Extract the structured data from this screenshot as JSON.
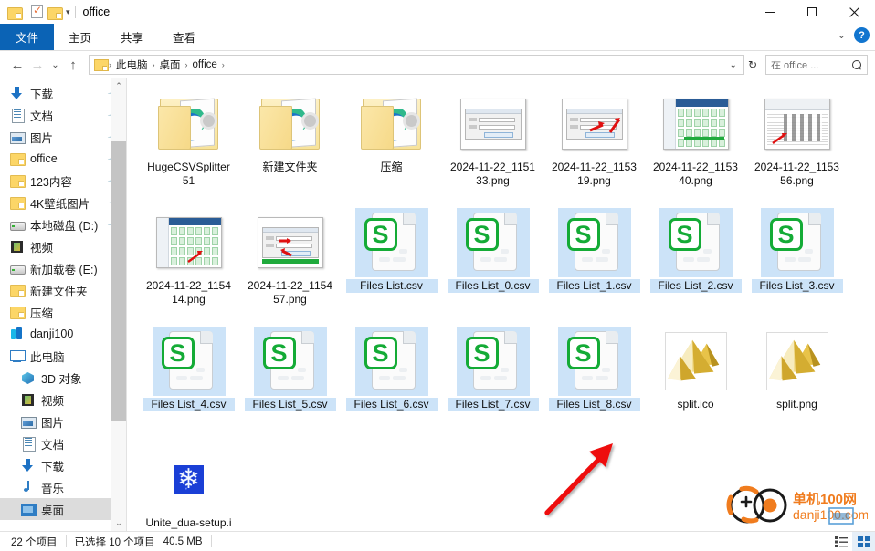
{
  "window": {
    "title": "office",
    "quick_access": [
      "folder-icon",
      "properties-icon",
      "new-folder-icon",
      "customize-caret-icon"
    ],
    "minimize": "—",
    "maximize": "□",
    "close": "✕",
    "ribbon_collapse": "⌄",
    "help": "?"
  },
  "ribbon": {
    "tabs": [
      {
        "label": "文件",
        "active": true
      },
      {
        "label": "主页",
        "active": false
      },
      {
        "label": "共享",
        "active": false
      },
      {
        "label": "查看",
        "active": false
      }
    ]
  },
  "address": {
    "back": "←",
    "forward": "→",
    "recent": "⌄",
    "up": "↑",
    "crumbs": [
      "此电脑",
      "桌面",
      "office"
    ],
    "separator": "›",
    "dropdown": "⌄",
    "refresh": "↻",
    "search_placeholder": "在 office ...",
    "search_value": ""
  },
  "sidebar": {
    "items": [
      {
        "label": "下载",
        "icon": "download-icon",
        "pinned": true,
        "indent": 0,
        "selected": false
      },
      {
        "label": "文档",
        "icon": "document-icon",
        "pinned": true,
        "indent": 0,
        "selected": false
      },
      {
        "label": "图片",
        "icon": "pictures-icon",
        "pinned": true,
        "indent": 0,
        "selected": false
      },
      {
        "label": "office",
        "icon": "folder-icon",
        "pinned": true,
        "indent": 0,
        "selected": false
      },
      {
        "label": "123内容",
        "icon": "folder-icon",
        "pinned": true,
        "indent": 0,
        "selected": false
      },
      {
        "label": "4K壁纸图片",
        "icon": "folder-icon",
        "pinned": true,
        "indent": 0,
        "selected": false
      },
      {
        "label": "本地磁盘 (D:)",
        "icon": "drive-icon",
        "pinned": true,
        "indent": 0,
        "selected": false
      },
      {
        "label": "视频",
        "icon": "video-icon",
        "pinned": false,
        "indent": 0,
        "selected": false
      },
      {
        "label": "新加载卷 (E:)",
        "icon": "drive-icon",
        "pinned": false,
        "indent": 0,
        "selected": false
      },
      {
        "label": "新建文件夹",
        "icon": "folder-icon",
        "pinned": false,
        "indent": 0,
        "selected": false
      },
      {
        "label": "压缩",
        "icon": "folder-icon",
        "pinned": false,
        "indent": 0,
        "selected": false
      },
      {
        "label": "danji100",
        "icon": "cloud-drive-icon",
        "pinned": false,
        "indent": 0,
        "selected": false
      },
      {
        "label": "此电脑",
        "icon": "this-pc-icon",
        "pinned": false,
        "indent": 0,
        "selected": false
      },
      {
        "label": "3D 对象",
        "icon": "3d-objects-icon",
        "pinned": false,
        "indent": 1,
        "selected": false
      },
      {
        "label": "视频",
        "icon": "video-icon",
        "pinned": false,
        "indent": 1,
        "selected": false
      },
      {
        "label": "图片",
        "icon": "pictures-icon",
        "pinned": false,
        "indent": 1,
        "selected": false
      },
      {
        "label": "文档",
        "icon": "document-icon",
        "pinned": false,
        "indent": 1,
        "selected": false
      },
      {
        "label": "下载",
        "icon": "download-icon",
        "pinned": false,
        "indent": 1,
        "selected": false
      },
      {
        "label": "音乐",
        "icon": "music-icon",
        "pinned": false,
        "indent": 1,
        "selected": false
      },
      {
        "label": "桌面",
        "icon": "desktop-icon",
        "pinned": false,
        "indent": 1,
        "selected": true
      }
    ],
    "scroll_up": "⌃",
    "scroll_down": "⌄"
  },
  "files": [
    {
      "name": "HugeCSVSplitter 51",
      "type": "folder",
      "selected": false,
      "line2": "r  51"
    },
    {
      "name": "新建文件夹",
      "type": "folder",
      "selected": false
    },
    {
      "name": "压缩",
      "type": "folder",
      "selected": false
    },
    {
      "name": "2024-11-22_115133.png",
      "type": "png-dialog",
      "selected": false
    },
    {
      "name": "2024-11-22_115319.png",
      "type": "png-dialog2",
      "selected": false
    },
    {
      "name": "2024-11-22_115340.png",
      "type": "png-grid",
      "selected": false
    },
    {
      "name": "2024-11-22_115356.png",
      "type": "png-excel",
      "selected": false
    },
    {
      "name": "2024-11-22_115414.png",
      "type": "png-grid2",
      "selected": false
    },
    {
      "name": "2024-11-22_115457.png",
      "type": "png-dialog3",
      "selected": false
    },
    {
      "name": "Files List.csv",
      "type": "csv",
      "selected": true
    },
    {
      "name": "Files List_0.csv",
      "type": "csv",
      "selected": true
    },
    {
      "name": "Files List_1.csv",
      "type": "csv",
      "selected": true
    },
    {
      "name": "Files List_2.csv",
      "type": "csv",
      "selected": true
    },
    {
      "name": "Files List_3.csv",
      "type": "csv",
      "selected": true
    },
    {
      "name": "Files List_4.csv",
      "type": "csv",
      "selected": true
    },
    {
      "name": "Files List_5.csv",
      "type": "csv",
      "selected": true
    },
    {
      "name": "Files List_6.csv",
      "type": "csv",
      "selected": true
    },
    {
      "name": "Files List_7.csv",
      "type": "csv",
      "selected": true
    },
    {
      "name": "Files List_8.csv",
      "type": "csv",
      "selected": true
    },
    {
      "name": "split.ico",
      "type": "pyramid",
      "selected": false
    },
    {
      "name": "split.png",
      "type": "pyramid",
      "selected": false
    },
    {
      "name": "Unite_dua-setup.ico",
      "type": "snowflake",
      "selected": false
    }
  ],
  "status": {
    "item_count": "22 个项目",
    "selection": "已选择 10 个项目",
    "size": "40.5 MB"
  },
  "watermark": {
    "line1": "单机100网",
    "line2": "danji100.com"
  },
  "annotation": {
    "arrow_color": "#ee1111",
    "points_at": "Files List_8.csv"
  },
  "colors": {
    "accent": "#0b63b5",
    "selection": "#cce3f8",
    "csv_green": "#14ab36",
    "folder_yellow": "#fcd667",
    "watermark_orange": "#f07c1e"
  }
}
